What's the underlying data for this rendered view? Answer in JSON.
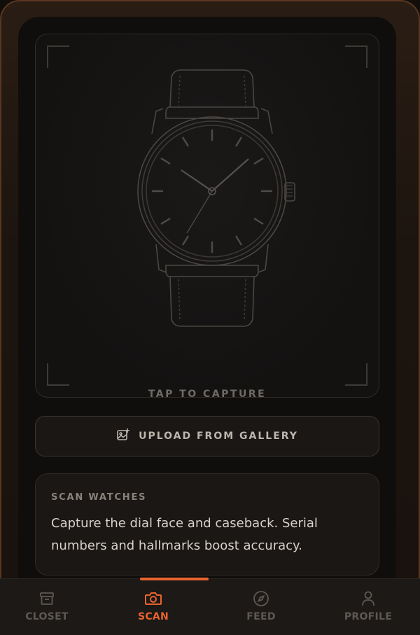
{
  "capture": {
    "label": "TAP TO CAPTURE"
  },
  "upload": {
    "label": "UPLOAD FROM GALLERY",
    "icon": "image-add-icon"
  },
  "info": {
    "heading": "SCAN WATCHES",
    "body": "Capture the dial face and caseback. Serial numbers and hallmarks boost accuracy."
  },
  "tabs": [
    {
      "label": "CLOSET",
      "icon": "archive-box-icon",
      "active": false
    },
    {
      "label": "SCAN",
      "icon": "camera-icon",
      "active": true
    },
    {
      "label": "FEED",
      "icon": "compass-icon",
      "active": false
    },
    {
      "label": "PROFILE",
      "icon": "user-icon",
      "active": false
    }
  ],
  "colors": {
    "accent": "#e8642c",
    "background": "#100e0d",
    "card": "#1a1715",
    "inactive_tab": "#5e5852"
  }
}
